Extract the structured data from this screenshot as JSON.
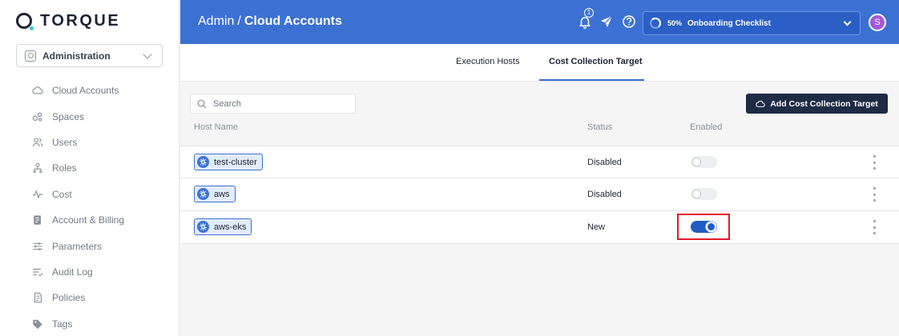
{
  "brand": {
    "name": "TORQUE"
  },
  "space_selector": {
    "value": "Administration"
  },
  "sidebar": {
    "items": [
      {
        "label": "Cloud Accounts",
        "icon": "cloud-icon"
      },
      {
        "label": "Spaces",
        "icon": "spaces-icon"
      },
      {
        "label": "Users",
        "icon": "users-icon"
      },
      {
        "label": "Roles",
        "icon": "roles-icon"
      },
      {
        "label": "Cost",
        "icon": "cost-icon"
      },
      {
        "label": "Account & Billing",
        "icon": "billing-icon"
      },
      {
        "label": "Parameters",
        "icon": "sliders-icon"
      },
      {
        "label": "Audit Log",
        "icon": "audit-log-icon"
      },
      {
        "label": "Policies",
        "icon": "policies-icon"
      },
      {
        "label": "Tags",
        "icon": "tag-icon"
      }
    ]
  },
  "header": {
    "breadcrumb_parent": "Admin",
    "separator": "/",
    "title": "Cloud Accounts",
    "notification_count": "1",
    "onboarding_percent": "50%",
    "onboarding_label": "Onboarding Checklist",
    "avatar_initial": "S",
    "bg_color": "#3c71d4"
  },
  "tabs": [
    {
      "label": "Execution Hosts",
      "active": false
    },
    {
      "label": "Cost Collection Target",
      "active": true
    }
  ],
  "search": {
    "placeholder": "Search",
    "value": ""
  },
  "actions": {
    "add_label": "Add Cost Collection Target"
  },
  "table": {
    "columns": [
      "Host Name",
      "Status",
      "Enabled"
    ],
    "rows": [
      {
        "host": "test-cluster",
        "status": "Disabled",
        "enabled": false
      },
      {
        "host": "aws",
        "status": "Disabled",
        "enabled": false
      },
      {
        "host": "aws-eks",
        "status": "New",
        "enabled": true
      }
    ]
  },
  "highlight_color": "#e41a2a"
}
